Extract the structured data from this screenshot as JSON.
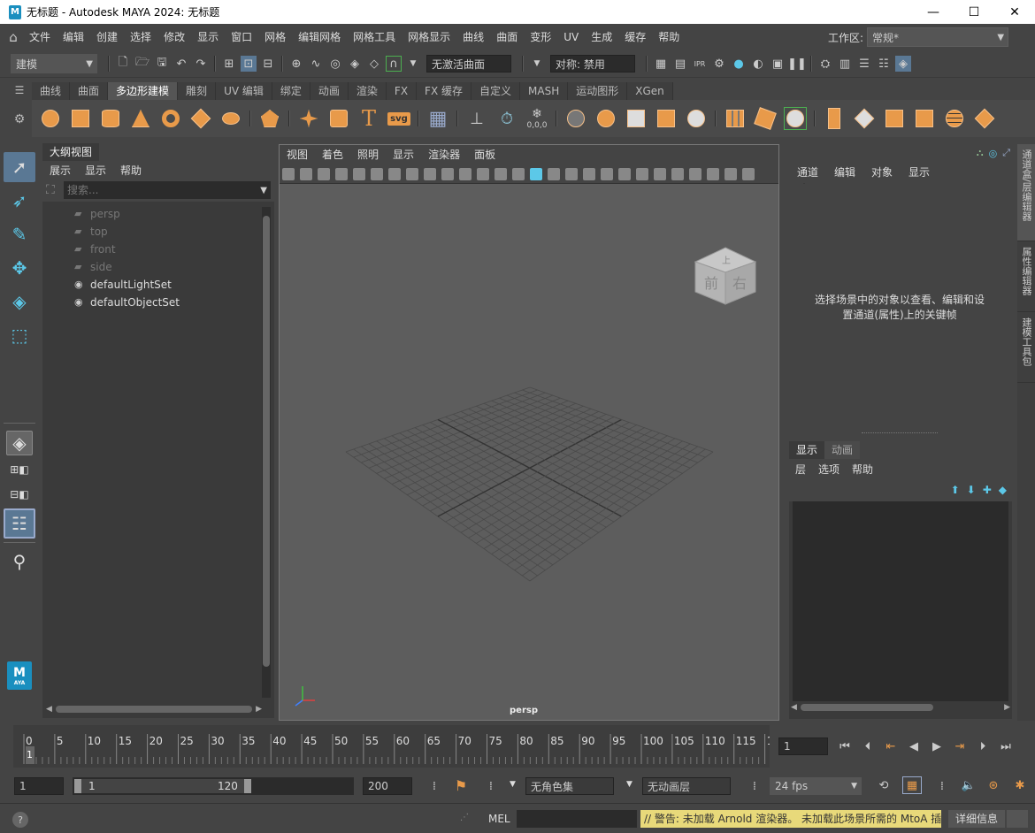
{
  "window": {
    "title": "无标题 - Autodesk MAYA 2024: 无标题",
    "logo_text": "M",
    "minimize": "—",
    "maximize": "☐",
    "close": "✕"
  },
  "menubar": {
    "items": [
      "文件",
      "编辑",
      "创建",
      "选择",
      "修改",
      "显示",
      "窗口",
      "网格",
      "编辑网格",
      "网格工具",
      "网格显示",
      "曲线",
      "曲面",
      "变形",
      "UV",
      "生成",
      "缓存",
      "帮助"
    ],
    "workspace_label": "工作区:",
    "workspace_value": "常规*"
  },
  "statusline": {
    "mode": "建模",
    "live_surface": "无激活曲面",
    "symmetry": "对称: 禁用"
  },
  "shelf": {
    "tabs": [
      "曲线",
      "曲面",
      "多边形建模",
      "雕刻",
      "UV 编辑",
      "绑定",
      "动画",
      "渲染",
      "FX",
      "FX 缓存",
      "自定义",
      "MASH",
      "运动图形",
      "XGen"
    ],
    "active_tab": "多边形建模",
    "text_tool": "T",
    "svg_tool": "svg",
    "coord_label": "0,0,0"
  },
  "outliner": {
    "title": "大纲视图",
    "menu": [
      "展示",
      "显示",
      "帮助"
    ],
    "search_placeholder": "搜索...",
    "items": [
      {
        "name": "persp",
        "dim": true
      },
      {
        "name": "top",
        "dim": true
      },
      {
        "name": "front",
        "dim": true
      },
      {
        "name": "side",
        "dim": true
      },
      {
        "name": "defaultLightSet",
        "dim": false
      },
      {
        "name": "defaultObjectSet",
        "dim": false
      }
    ]
  },
  "viewport": {
    "menu": [
      "视图",
      "着色",
      "照明",
      "显示",
      "渲染器",
      "面板"
    ],
    "camera_label": "persp",
    "viewcube_top": "上",
    "viewcube_front": "前",
    "viewcube_right": "右"
  },
  "channelbox": {
    "menu": [
      "通道",
      "编辑",
      "对象",
      "显示"
    ],
    "empty_message_line1": "选择场景中的对象以查看、编辑和设",
    "empty_message_line2": "置通道(属性)上的关键帧",
    "layer_tabs": [
      "显示",
      "动画"
    ],
    "layer_menu": [
      "层",
      "选项",
      "帮助"
    ]
  },
  "side_tabs": [
    "通道盒/层编辑器",
    "属性编辑器",
    "建模工具包"
  ],
  "timeline": {
    "ticks": [
      "0",
      "5",
      "10",
      "15",
      "20",
      "25",
      "30",
      "35",
      "40",
      "45",
      "50",
      "55",
      "60",
      "65",
      "70",
      "75",
      "80",
      "85",
      "90",
      "95",
      "100",
      "105",
      "110",
      "115",
      "1"
    ],
    "current_frame_marker": "1",
    "current_frame": "1"
  },
  "range": {
    "start": "1",
    "range_start": "1",
    "range_end": "120",
    "end": "200",
    "char_set": "无角色集",
    "anim_layer": "无动画层",
    "fps": "24 fps"
  },
  "commandline": {
    "help": "?",
    "lang": "MEL",
    "warning": "// 警告: 未加载 Arnold 渲染器。 未加载此场景所需的 MtoA 插",
    "details_button": "详细信息"
  }
}
